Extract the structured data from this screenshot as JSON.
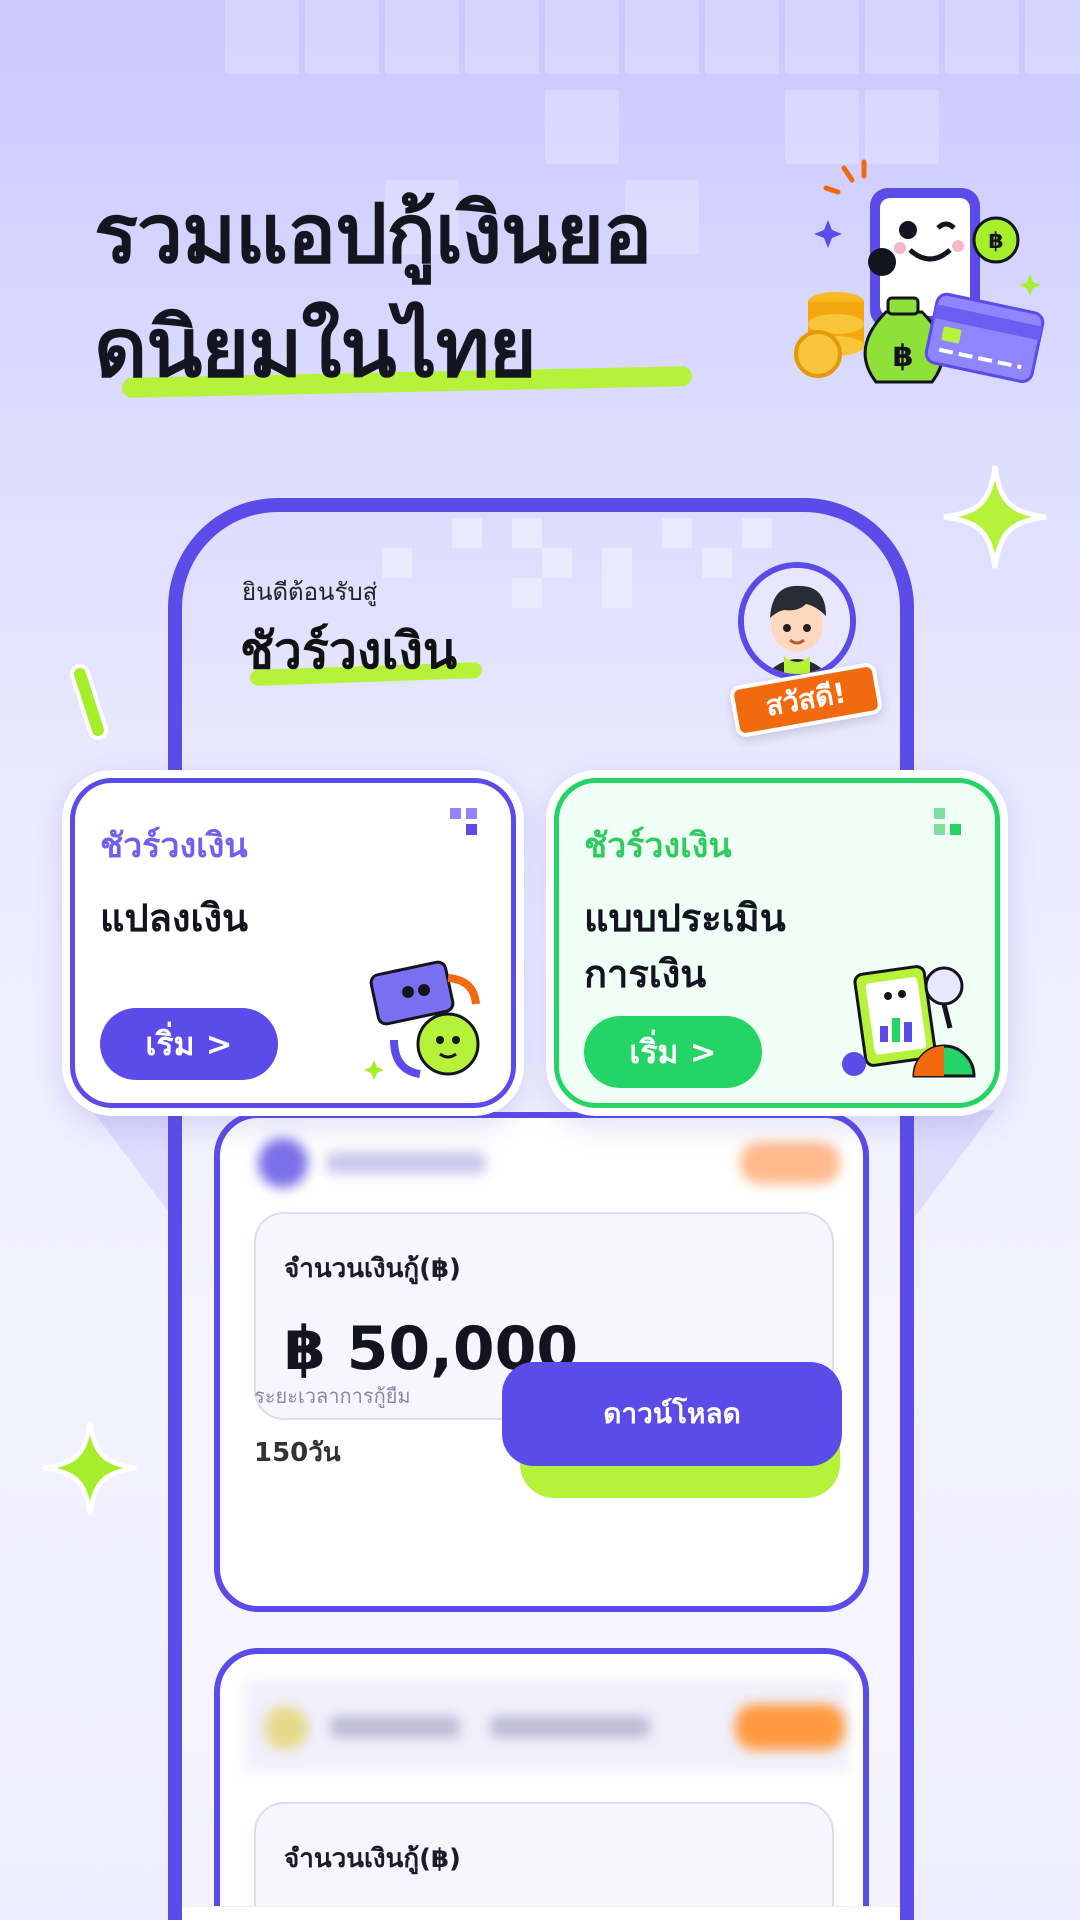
{
  "headline": {
    "line1": "รวมแอปกู้เงินยอ",
    "line2": "ดนิยมในไทย"
  },
  "header": {
    "welcome": "ยินดีต้อนรับสู่",
    "app_name": "ชัวร์วงเงิน",
    "greeting_tag": "สวัสดี!"
  },
  "feature_cards": [
    {
      "brand": "ชัวร์วงเงิน",
      "title": "แปลงเงิน",
      "button": "เริ่ม >",
      "color": "#5b4be8"
    },
    {
      "brand": "ชัวร์วงเงิน",
      "title": "แบบประเมิน\nการเงิน",
      "title_line1": "แบบประเมิน",
      "title_line2": "การเงิน",
      "button": "เริ่ม >",
      "color": "#25d466"
    }
  ],
  "loan_cards": [
    {
      "amount_label": "จำนวนเงินกู้(฿)",
      "amount": "฿  50,000",
      "term_label": "ระยะเวลาการกู้ยืม",
      "term_value": "150วัน",
      "download": "ดาวน์โหลด"
    },
    {
      "amount_label": "จำนวนเงินกู้(฿)"
    }
  ],
  "colors": {
    "primary": "#5b4be8",
    "accent_lime": "#b7f23a",
    "green": "#25d466",
    "orange": "#f26a10"
  },
  "icons": [
    "phone-mascot-icon",
    "coins-icon",
    "money-bag-icon",
    "credit-card-icon",
    "sparkle-icon",
    "avatar-icon",
    "home-icon"
  ]
}
